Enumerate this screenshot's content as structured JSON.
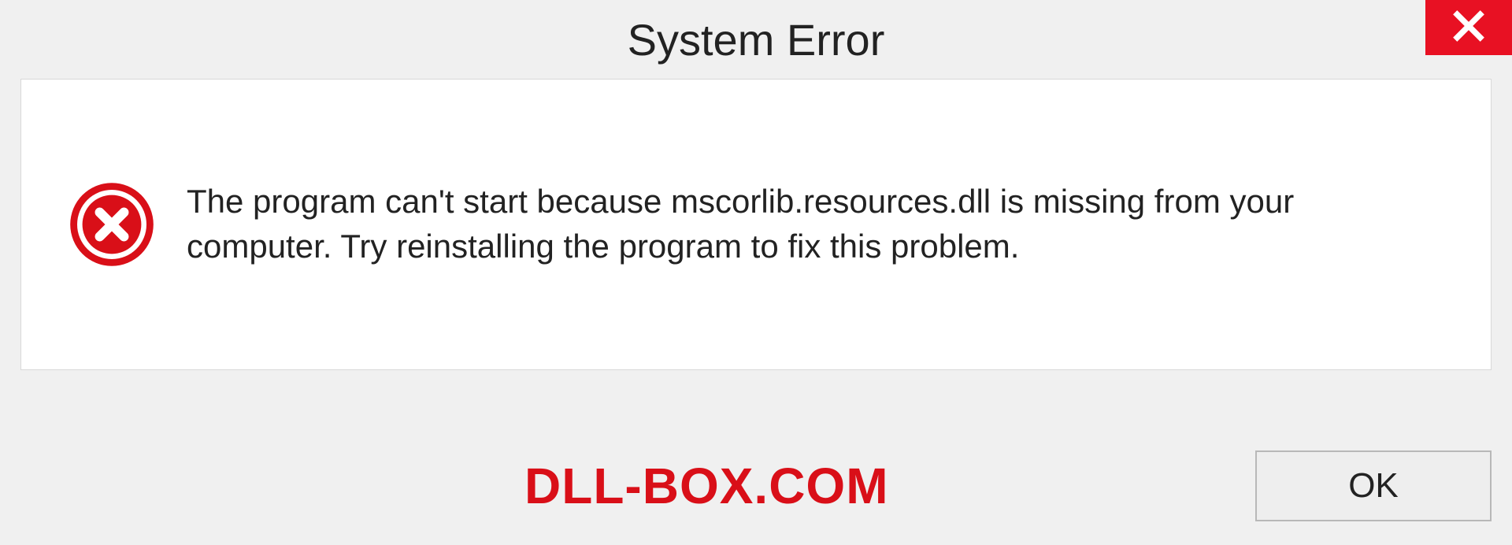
{
  "dialog": {
    "title": "System Error",
    "message": "The program can't start because mscorlib.resources.dll is missing from your computer. Try reinstalling the program to fix this problem.",
    "ok_label": "OK"
  },
  "watermark": "DLL-BOX.COM",
  "colors": {
    "close_bg": "#e81123",
    "error_red": "#d90f18"
  }
}
